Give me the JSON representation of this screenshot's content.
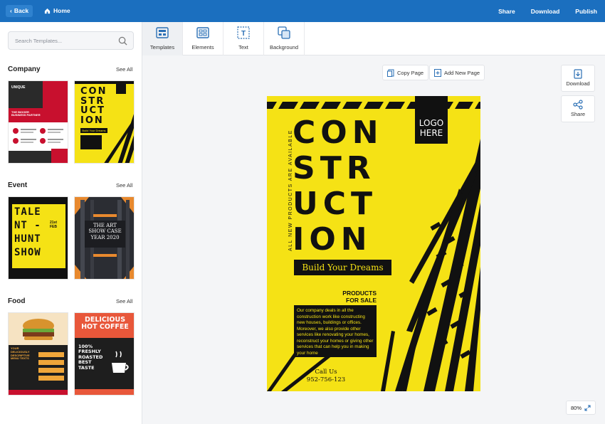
{
  "topbar": {
    "back_label": "Back",
    "home_label": "Home",
    "share_label": "Share",
    "download_label": "Download",
    "publish_label": "Publish",
    "bg_color": "#1b6fbf"
  },
  "sidebar": {
    "search_placeholder": "Search Templates...",
    "see_all_label": "See All",
    "sections": [
      {
        "title": "Company"
      },
      {
        "title": "Event"
      },
      {
        "title": "Food"
      }
    ],
    "thumbs": {
      "company_1": {
        "title": "THE BIGGER BUSINESS PARTNER",
        "logo": "UNIQUE"
      },
      "company_2": {
        "lines": [
          "CON",
          "STR",
          "UCT",
          "ION"
        ],
        "tag": "Build Your Dreams"
      },
      "event_1": {
        "lines": [
          "TALE",
          "NT -",
          "HUNT",
          "SHOW"
        ],
        "date": "21st FEB"
      },
      "event_2": {
        "title": "THE ART SHOW CASE YEAR 2020"
      },
      "food_1": {
        "title": "YOUR DELICIOUSLY DESCRIPTIVE MENU TEXTS"
      },
      "food_2": {
        "title": "DELICIOUS HOT COFFEE",
        "sub": "100% FRESHLY ROASTED BEST TASTE"
      }
    }
  },
  "toolbar": {
    "tools": [
      {
        "label": "Templates",
        "icon": "templates-icon"
      },
      {
        "label": "Elements",
        "icon": "elements-icon"
      },
      {
        "label": "Text",
        "icon": "text-icon"
      },
      {
        "label": "Background",
        "icon": "background-icon"
      }
    ]
  },
  "canvas": {
    "copy_page_label": "Copy Page",
    "add_new_page_label": "Add New Page",
    "side_download_label": "Download",
    "side_share_label": "Share",
    "zoom_label": "80%"
  },
  "flyer": {
    "lines": [
      "CON",
      "STR",
      "UCT",
      "ION"
    ],
    "logo_line1": "LOGO",
    "logo_line2": "HERE",
    "vertical_text": "ALL NEW PRODUCTS ARE AVAILABLE",
    "tagline": "Build Your Dreams",
    "products_line1": "PRODUCTS",
    "products_line2": "FOR SALE",
    "description": "Our company deals in all the construction work like constructing new houses, buildings or offices. Moreover, we also provide other services like renovating your homes, reconstruct your homes or giving other services that can help you in making your home",
    "call_us": "Call Us",
    "phone": "952-756-123",
    "yellow": "#f5e215",
    "black": "#111111"
  }
}
